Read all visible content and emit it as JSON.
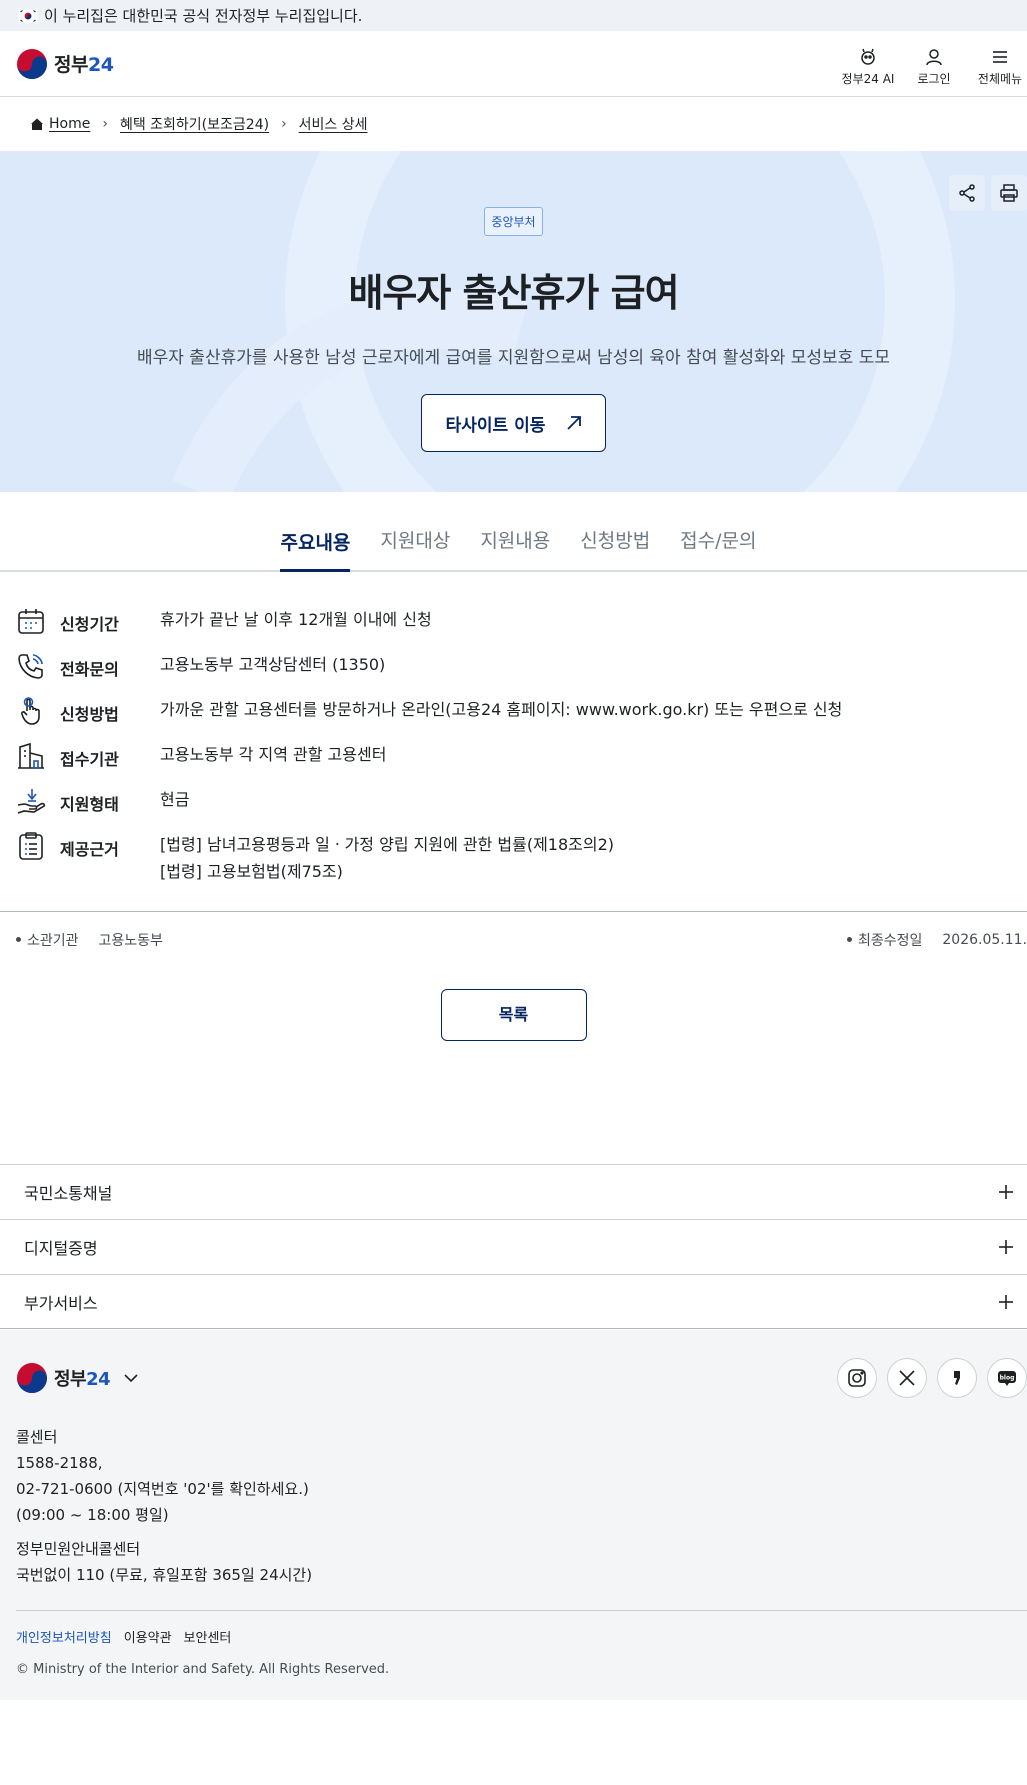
{
  "banner": {
    "text": "이 누리집은 대한민국 공식 전자정부 누리집입니다."
  },
  "header": {
    "logo_text": "정부",
    "logo_num": "24",
    "actions": [
      {
        "label": "정부24 AI",
        "icon": "ai-icon"
      },
      {
        "label": "로그인",
        "icon": "user-icon"
      },
      {
        "label": "전체메뉴",
        "icon": "menu-icon"
      }
    ]
  },
  "breadcrumb": {
    "home": "Home",
    "items": [
      "혜택 조회하기(보조금24)",
      "서비스 상세"
    ]
  },
  "hero": {
    "badge": "중앙부처",
    "title": "배우자 출산휴가 급여",
    "description": "배우자 출산휴가를 사용한 남성 근로자에게 급여를 지원함으로써 남성의 육아 참여 활성화와 모성보호 도모",
    "button": "타사이트 이동"
  },
  "tabs": [
    "주요내용",
    "지원대상",
    "지원내용",
    "신청방법",
    "접수/문의"
  ],
  "info": [
    {
      "label": "신청기간",
      "value": "휴가가 끝난 날 이후 12개월 이내에 신청",
      "icon": "calendar-icon"
    },
    {
      "label": "전화문의",
      "value": "고용노동부 고객상담센터 (1350)",
      "icon": "phone-icon"
    },
    {
      "label": "신청방법",
      "value": "가까운 관할 고용센터를 방문하거나 온라인(고용24 홈페이지: www.work.go.kr) 또는 우편으로 신청",
      "icon": "hand-pointer-icon"
    },
    {
      "label": "접수기관",
      "value": "고용노동부 각 지역 관할 고용센터",
      "icon": "building-icon"
    },
    {
      "label": "지원형태",
      "value": "현금",
      "icon": "hand-money-icon"
    },
    {
      "label": "제공근거",
      "value": "[법령] 남녀고용평등과 일ㆍ가정 양립 지원에 관한 법률(제18조의2)",
      "value2": "[법령] 고용보험법(제75조)",
      "icon": "clipboard-icon"
    }
  ],
  "meta": {
    "dept_label": "소관기관",
    "dept_value": "고용노동부",
    "updated_label": "최종수정일",
    "updated_value": "2026.05.11."
  },
  "list_button": "목록",
  "accordions": [
    "국민소통채널",
    "디지털증명",
    "부가서비스"
  ],
  "footer": {
    "contact_title": "콜센터",
    "contact_lines": [
      "1588-2188,",
      "02-721-0600 (지역번호 '02'를 확인하세요.)",
      "(09:00 ~ 18:00 평일)"
    ],
    "gov_title": "정부민원안내콜센터",
    "gov_line": "국번없이 110 (무료, 휴일포함 365일 24시간)",
    "links": [
      "개인정보처리방침",
      "이용약관",
      "보안센터"
    ],
    "copyright": "© Ministry of the Interior and Safety. All Rights Reserved.",
    "social": [
      "instagram-icon",
      "x-icon",
      "kakao-story-icon",
      "blog-icon"
    ],
    "social_blog_text": "blog"
  },
  "colors": {
    "primary": "#052561",
    "accent": "#1d56bc",
    "hero_bg": "#dce9fb"
  }
}
